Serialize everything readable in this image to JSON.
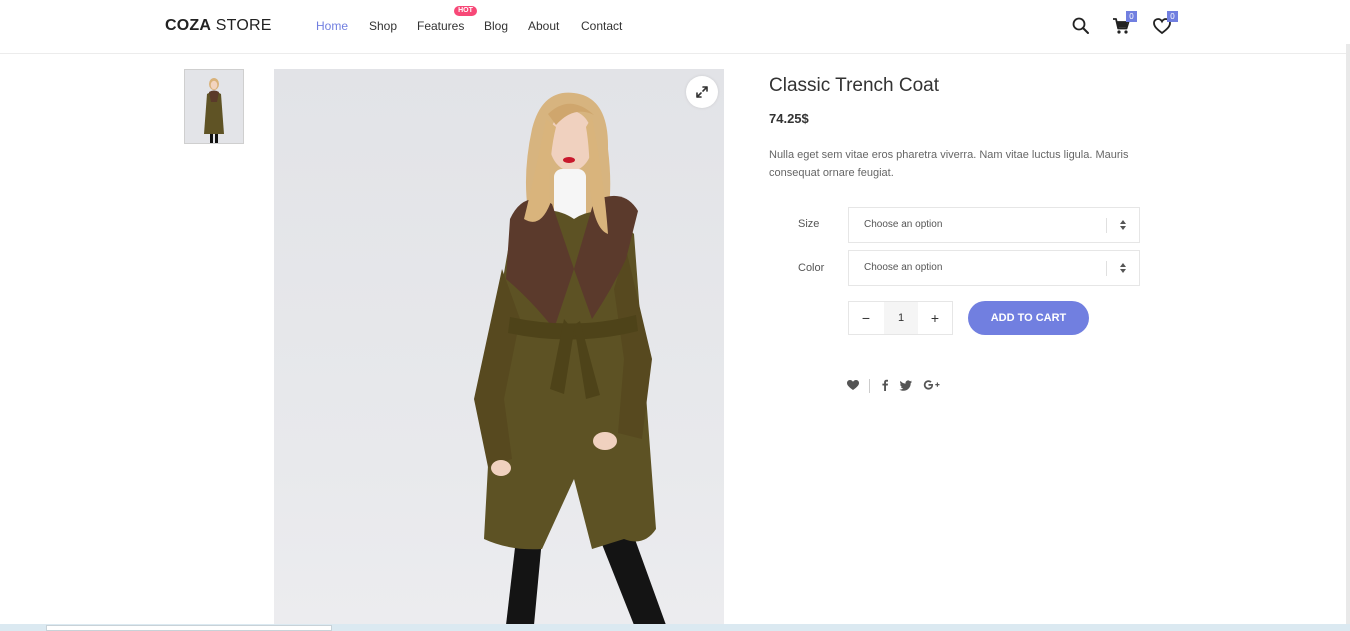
{
  "header": {
    "logo_bold": "COZA",
    "logo_rest": " STORE",
    "nav": [
      {
        "label": "Home",
        "active": true
      },
      {
        "label": "Shop",
        "active": false
      },
      {
        "label": "Features",
        "active": false
      },
      {
        "label": "Blog",
        "active": false
      },
      {
        "label": "About",
        "active": false
      },
      {
        "label": "Contact",
        "active": false
      }
    ],
    "hot_badge": "HOT",
    "cart_count": "0",
    "wishlist_count": "0",
    "accent_color": "#717fe0",
    "hot_color": "#f74877"
  },
  "product": {
    "name": "Classic Trench Coat",
    "price": "74.25$",
    "description": "Nulla eget sem vitae eros pharetra viverra. Nam vitae luctus ligula. Mauris consequat ornare feugiat.",
    "options": {
      "size_label": "Size",
      "size_value": "Choose an option",
      "color_label": "Color",
      "color_value": "Choose an option"
    },
    "quantity": "1",
    "qty_minus": "−",
    "qty_plus": "+",
    "add_to_cart": "ADD TO CART",
    "share_icons": [
      "heart-icon",
      "facebook-icon",
      "twitter-icon",
      "google-plus-icon"
    ]
  }
}
